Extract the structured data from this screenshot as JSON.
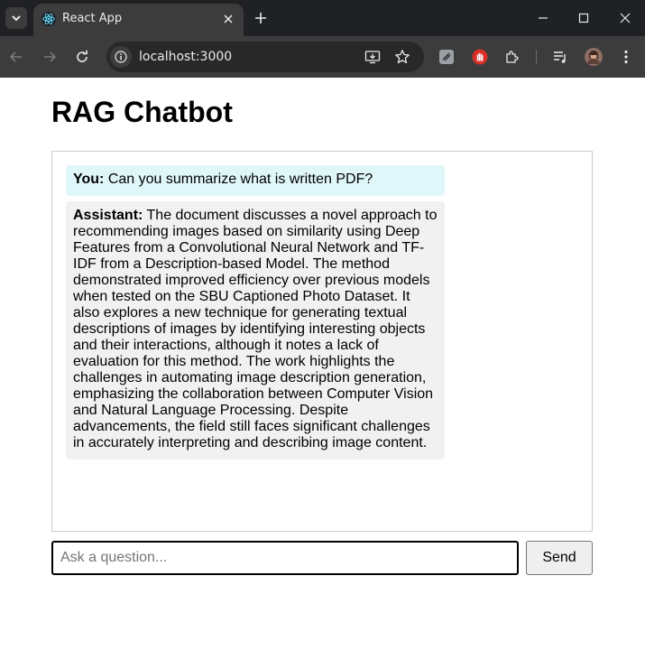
{
  "browser": {
    "tab": {
      "title": "React App",
      "favicon": "react-logo-icon"
    },
    "url": "localhost:3000",
    "icons": {
      "tab_search": "chevron-down-icon",
      "tab_close": "close-icon",
      "new_tab": "plus-icon",
      "minimize": "minimize-icon",
      "maximize": "maximize-icon",
      "close_window": "close-icon",
      "back": "back-arrow-icon",
      "forward": "forward-arrow-icon",
      "reload": "reload-icon",
      "site_info": "info-icon",
      "install": "install-app-icon",
      "bookmark": "star-icon",
      "extension_1": "gray-extension-icon",
      "extension_2": "stop-hand-extension-icon",
      "extensions": "puzzle-icon",
      "media": "media-control-icon",
      "profile": "avatar",
      "menu": "kebab-menu-icon"
    },
    "colors": {
      "chrome_dark": "#202124",
      "toolbar": "#3c3c3c"
    }
  },
  "page": {
    "title": "RAG Chatbot",
    "messages": [
      {
        "role": "user",
        "speaker": "You:",
        "text": "Can you summarize what is written PDF?",
        "bg": "#e0f7fa"
      },
      {
        "role": "assistant",
        "speaker": "Assistant:",
        "text": "The document discusses a novel approach to recommending images based on similarity using Deep Features from a Convolutional Neural Network and TF-IDF from a Description-based Model. The method demonstrated improved efficiency over previous models when tested on the SBU Captioned Photo Dataset. It also explores a new technique for generating textual descriptions of images by identifying interesting objects and their interactions, although it notes a lack of evaluation for this method. The work highlights the challenges in automating image description generation, emphasizing the collaboration between Computer Vision and Natural Language Processing. Despite advancements, the field still faces significant challenges in accurately interpreting and describing image content.",
        "bg": "#f1f1f1"
      }
    ],
    "input": {
      "placeholder": "Ask a question...",
      "value": ""
    },
    "send_label": "Send"
  }
}
